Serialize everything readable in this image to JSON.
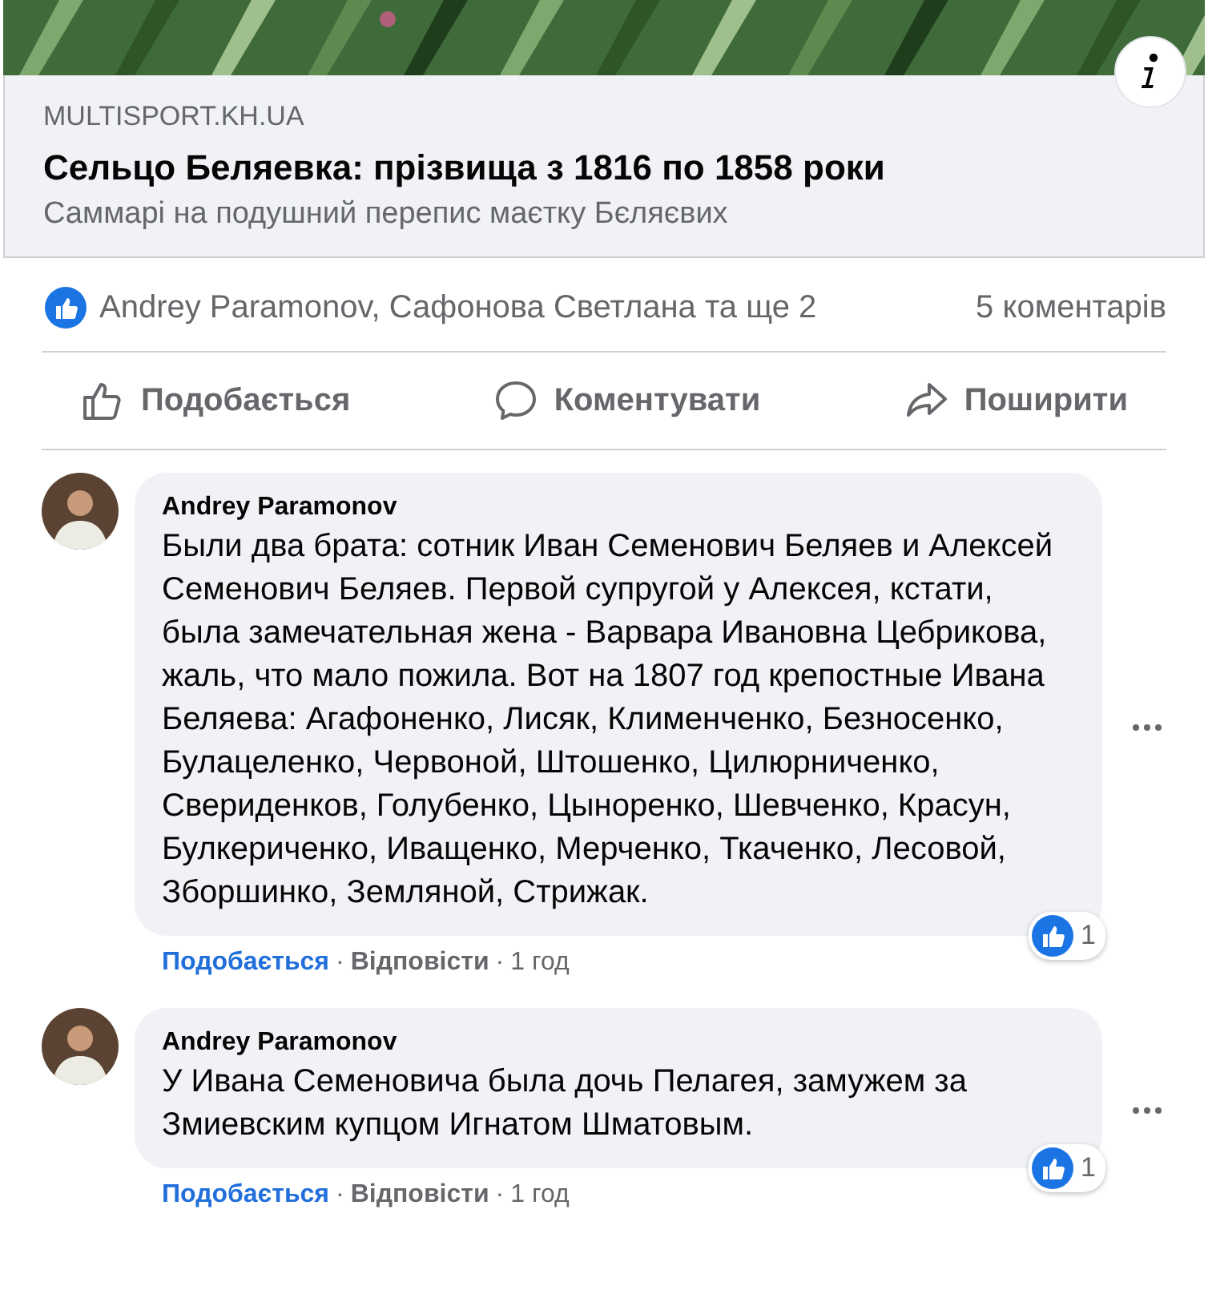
{
  "link_preview": {
    "kind": "picture",
    "domain": "MULTISPORT.KH.UA",
    "title": "Сельцо Беляевка: прізвища з 1816 по 1858 роки",
    "description": "Саммарі на подушний перепис маєтку Бєляєвих"
  },
  "reactions": {
    "names": "Andrey Paramonov, Сафонова Светлана та ще 2",
    "comments_count": "5 коментарів"
  },
  "actions": [
    {
      "kind": "like",
      "label": "Подобається"
    },
    {
      "kind": "comment",
      "label": "Коментувати"
    },
    {
      "kind": "share",
      "label": "Поширити"
    }
  ],
  "comments": [
    {
      "author": "Andrey Paramonov",
      "text": "Были два брата: сотник Иван Семенович Беляев и Алексей Семенович Беляев. Первой супругой у Алексея, кстати, была замечательная жена - Варвара Ивановна Цебрикова, жаль, что мало пожила. Вот на 1807 год крепостные Ивана Беляева: Агафоненко, Лисяк, Клименченко, Безносенко, Булацеленко, Червоной, Штошенко, Цилюрниченко, Свериденков, Голубенко, Цыноренко, Шевченко, Красун, Булкериченко, Иващенко, Мерченко, Ткаченко, Лесовой, Зборшинко, Земляной, Стрижак.",
      "reaction_count": "1",
      "like": "Подобається",
      "reply": "Відповісти",
      "time": "1 год"
    },
    {
      "author": "Andrey Paramonov",
      "text": "У Ивана Семеновича была дочь Пелагея, замужем за Змиевским купцом Игнатом Шматовым.",
      "reaction_count": "1",
      "like": "Подобається",
      "reply": "Відповісти",
      "time": "1 год"
    }
  ],
  "separator": "·"
}
